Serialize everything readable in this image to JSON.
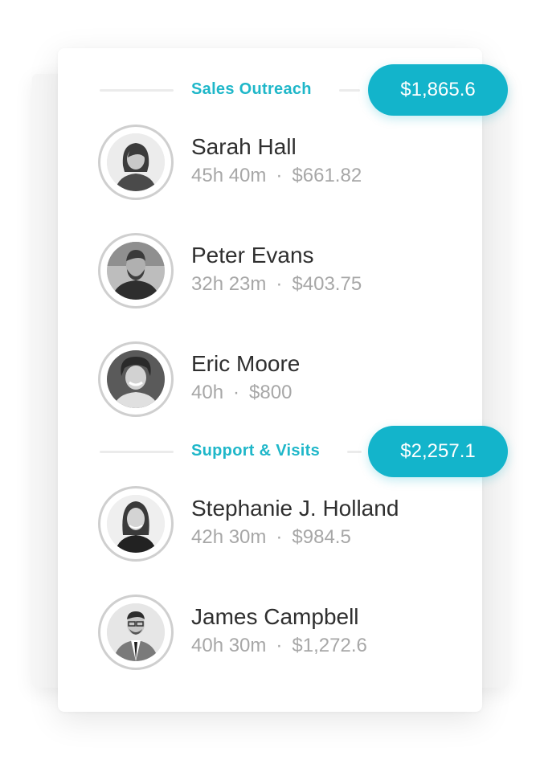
{
  "sections": [
    {
      "title": "Sales Outreach",
      "total": "$1,865.6",
      "people": [
        {
          "name": "Sarah Hall",
          "hours": "45h 40m",
          "amount": "$661.82"
        },
        {
          "name": "Peter Evans",
          "hours": "32h 23m",
          "amount": "$403.75"
        },
        {
          "name": "Eric Moore",
          "hours": "40h",
          "amount": "$800"
        }
      ]
    },
    {
      "title": "Support & Visits",
      "total": "$2,257.1",
      "people": [
        {
          "name": "Stephanie J. Holland",
          "hours": "42h 30m",
          "amount": "$984.5"
        },
        {
          "name": "James Campbell",
          "hours": "40h 30m",
          "amount": "$1,272.6"
        }
      ]
    }
  ],
  "separator": "·",
  "colors": {
    "accent": "#13b4cb",
    "accent_text": "#1fb7c9",
    "name_text": "#2f2f2f",
    "meta_text": "#a7a7a7"
  },
  "icons": {
    "avatar": "person-photo-avatar"
  }
}
